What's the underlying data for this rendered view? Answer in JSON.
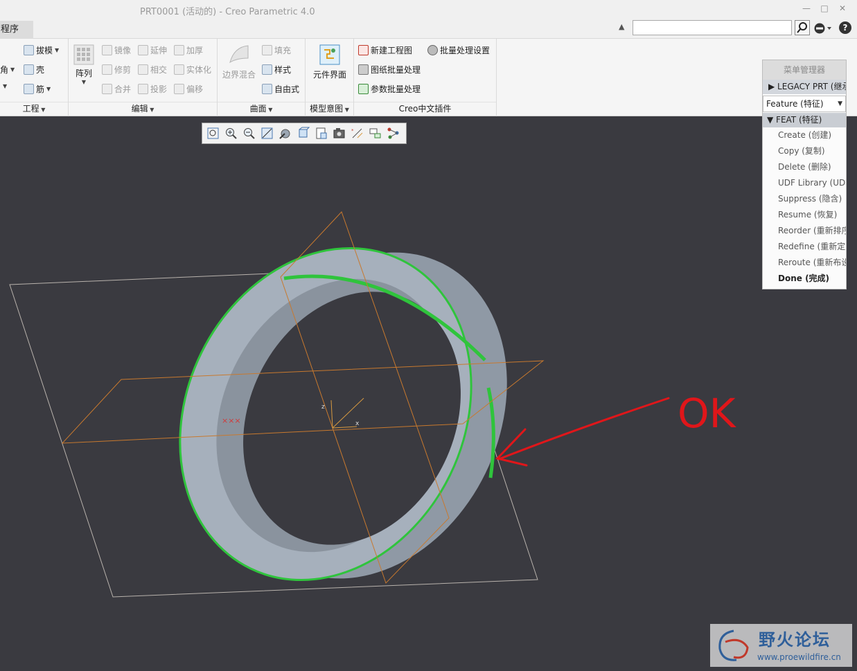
{
  "window": {
    "title": "PRT0001 (活动的) - Creo Parametric 4.0",
    "minimize_icon": "minimize-icon",
    "maximize_icon": "maximize-icon",
    "close_icon": "close-icon"
  },
  "tabs": {
    "active": "程序"
  },
  "search": {
    "value": "",
    "placeholder": ""
  },
  "ribbon": {
    "engineering": {
      "label": "工程",
      "items": [
        "拔模",
        "角",
        "壳",
        "筋"
      ]
    },
    "edit": {
      "label": "编辑",
      "pattern": "阵列",
      "items": [
        "镜像",
        "延伸",
        "加厚",
        "修剪",
        "相交",
        "实体化",
        "合并",
        "投影",
        "偏移"
      ]
    },
    "surface": {
      "label": "曲面",
      "boundary_blend": "边界混合",
      "items": [
        "填充",
        "样式",
        "自由式"
      ]
    },
    "model_intent": {
      "label": "模型意图",
      "component_interface": "元件界面"
    },
    "plugin": {
      "label": "Creo中文插件",
      "items": [
        "新建工程图",
        "批量处理设置",
        "图纸批量处理",
        "参数批量处理"
      ]
    }
  },
  "view_toolbar": {
    "icons": [
      "refit-icon",
      "zoom-in-icon",
      "zoom-out-icon",
      "repaint-icon",
      "display-style-icon",
      "saved-views-icon",
      "view-manager-icon",
      "perspective-icon",
      "datum-display-icon",
      "annotation-display-icon",
      "spin-center-icon"
    ]
  },
  "menu_manager": {
    "title": "菜单管理器",
    "legacy": "LEGACY PRT (继承",
    "selector": "Feature (特征)",
    "feat": "FEAT (特征)",
    "items": [
      "Create (创建)",
      "Copy (复制)",
      "Delete (删除)",
      "UDF Library (UDF",
      "Suppress (隐含)",
      "Resume (恢复)",
      "Reorder (重新排序",
      "Redefine (重新定义",
      "Reroute (重新布设",
      "Done (完成)"
    ]
  },
  "annotation": {
    "text": "OK"
  },
  "watermark": {
    "name": "野火论坛",
    "url": "www.proewildfire.cn"
  },
  "colors": {
    "viewport_bg": "#3a3a40",
    "ring_fill": "#a3adb9",
    "edge_highlight": "#2fc43c",
    "datum_plane": "#c8792e",
    "annotation": "#e0161a"
  }
}
